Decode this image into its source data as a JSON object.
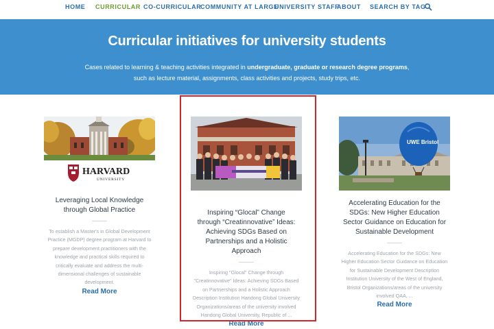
{
  "nav": {
    "items": [
      {
        "label": "HOME",
        "active": false
      },
      {
        "label": "CURRICULAR",
        "active": true
      },
      {
        "label": "CO-CURRICULAR",
        "active": false
      },
      {
        "label": "COMMUNITY AT LARGE",
        "active": false
      },
      {
        "label": "UNIVERSITY STAFF",
        "active": false
      },
      {
        "label": "ABOUT",
        "active": false
      },
      {
        "label": "SEARCH BY TAG",
        "active": false
      }
    ],
    "search_icon": "search-icon"
  },
  "hero": {
    "title": "Curricular initiatives for university students",
    "desc_part1": "Cases  related to learning & teaching activities integrated in ",
    "desc_bold": "undergraduate, graduate or research degree programs",
    "desc_part2": ", such as lecture material, assignments, class activities and projects, study trips, etc."
  },
  "cards": [
    {
      "logo_text": "HARVARD",
      "logo_subtext": "UNIVERSITY",
      "title": "Leveraging Local Knowledge through Global Practice",
      "desc": "To establish a Master's in Global Development Practice (MGDP) degree program at Harvard to prepare development practitioners with the knowledge and practical skills required to critically evaluate and address the multi-dimensional challenges of sustainable development.",
      "link": "Read More"
    },
    {
      "title": "Inspiring “Glocal” Change through “Creatinnovative” Ideas: Achieving SDGs Based on Partnerships and a Holistic Approach",
      "desc": "Inspiring \"Glocal\" Change through \"Creatinnovative\" Ideas: Achieving SDGs Based on Partnerships and a Holistic Approach Description Institution Handong Global University Organizations/areas of the university involved Handong Global University, Republic of ...",
      "link": "Read More"
    },
    {
      "balloon_text": "UWE Bristol",
      "title": "Accelerating Education for the SDGs: New Higher Education Sector Guidance on Education for Sustainable Development",
      "desc": "Accelerating Education for the SDGs: New Higher Education Sector Guidance on Education for Sustainable Development Description Institution University of the West of England, Bristol Organizations/areas of the university involved QAA, ...",
      "link": "Read More"
    }
  ],
  "colors": {
    "nav_link": "#2a6ea8",
    "nav_active": "#6b9b2c",
    "hero_bg": "#3d8fce",
    "highlight": "#d6232a"
  }
}
